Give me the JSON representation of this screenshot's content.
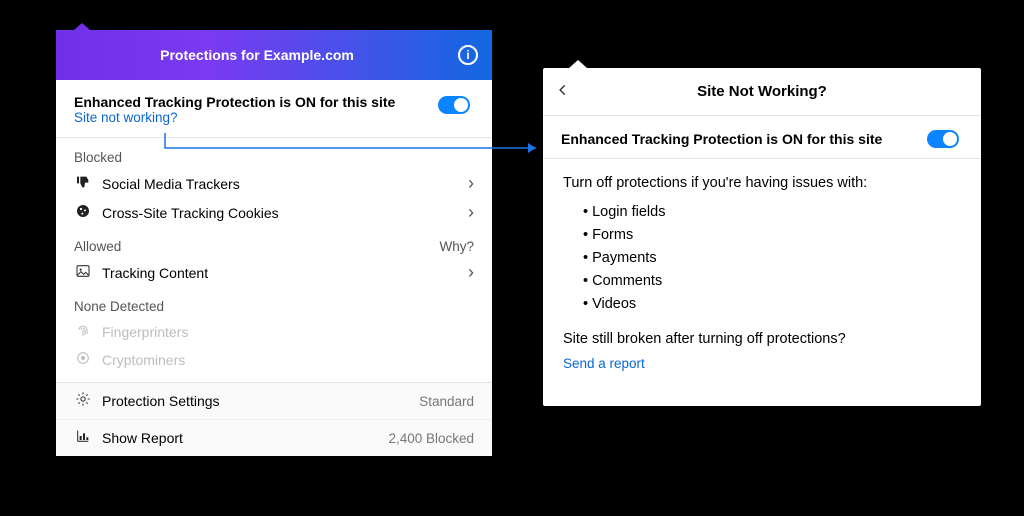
{
  "panel1": {
    "title": "Protections for Example.com",
    "etp_line": "Enhanced Tracking Protection is ON for this site",
    "site_not_working": "Site not working?",
    "blocked_label": "Blocked",
    "blocked": [
      {
        "label": "Social Media Trackers"
      },
      {
        "label": "Cross-Site Tracking Cookies"
      }
    ],
    "allowed_label": "Allowed",
    "why_label": "Why?",
    "allowed": [
      {
        "label": "Tracking Content"
      }
    ],
    "none_label": "None Detected",
    "none": [
      {
        "label": "Fingerprinters"
      },
      {
        "label": "Cryptominers"
      }
    ],
    "footer": {
      "settings_label": "Protection Settings",
      "settings_value": "Standard",
      "report_label": "Show Report",
      "report_value": "2,400 Blocked"
    }
  },
  "panel2": {
    "title": "Site Not Working?",
    "etp_line": "Enhanced Tracking Protection is ON for this site",
    "intro": "Turn off protections if you're having issues with:",
    "issues": [
      "Login fields",
      "Forms",
      "Payments",
      "Comments",
      "Videos"
    ],
    "still_broken": "Site still broken after turning off protections?",
    "send_report": "Send a report"
  }
}
